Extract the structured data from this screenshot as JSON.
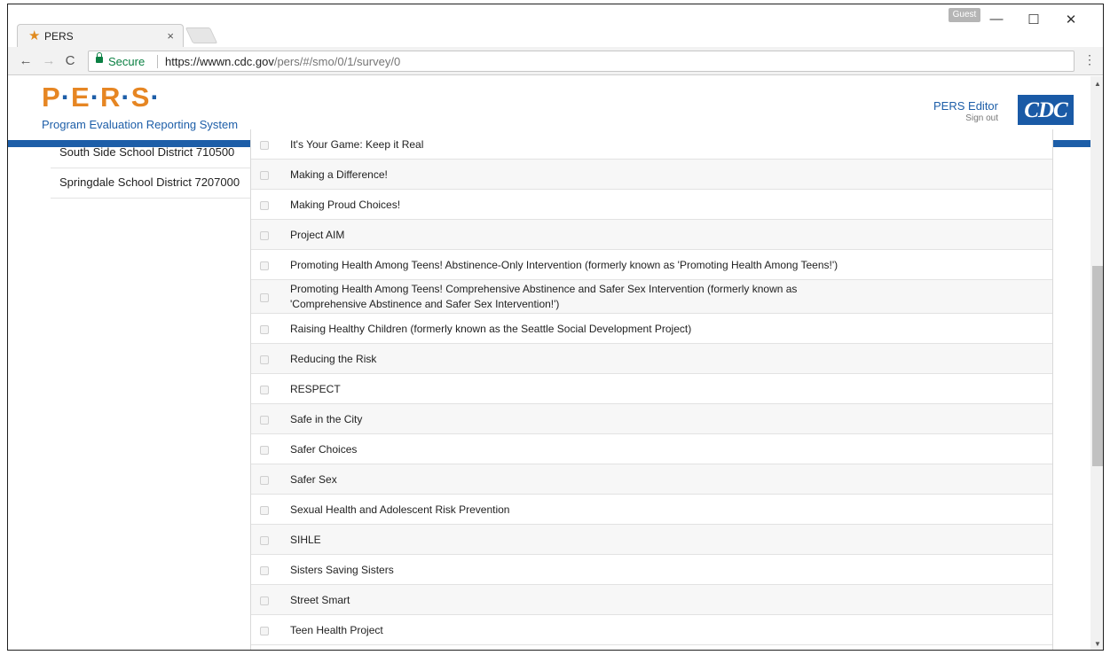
{
  "browser": {
    "tab_title": "PERS",
    "tab_close": "×",
    "profile": "Guest",
    "security_label": "Secure",
    "url_host": "https://wwwn.cdc.gov",
    "url_path": "/pers/#/smo/0/1/survey/0",
    "window_controls": {
      "minimize": "—",
      "maximize": "☐",
      "close": "✕"
    },
    "nav": {
      "back": "←",
      "forward": "→",
      "reload": "C",
      "menu": "⋮"
    }
  },
  "header": {
    "logo_letters": [
      "P",
      "E",
      "R",
      "S"
    ],
    "logo_sub": "Program Evaluation Reporting System",
    "editor_label": "PERS Editor",
    "signout_label": "Sign out",
    "cdc_logo": "CDC"
  },
  "sidebar": {
    "districts": [
      "South Side School District 710500",
      "Springdale School District 7207000"
    ]
  },
  "programs": [
    "It's Your Game: Keep it Real",
    "Making a Difference!",
    "Making Proud Choices!",
    "Project AIM",
    "Promoting Health Among Teens! Abstinence-Only Intervention (formerly known as 'Promoting Health Among Teens!')",
    "Promoting Health Among Teens! Comprehensive Abstinence and Safer Sex Intervention (formerly known as\n'Comprehensive Abstinence and Safer Sex Intervention!')",
    "Raising Healthy Children (formerly known as the Seattle Social Development Project)",
    "Reducing the Risk",
    "RESPECT",
    "Safe in the City",
    "Safer Choices",
    "Safer Sex",
    "Sexual Health and Adolescent Risk Prevention",
    "SIHLE",
    "Sisters Saving Sisters",
    "Street Smart",
    "Teen Health Project"
  ],
  "colors": {
    "brand_orange": "#e68623",
    "brand_blue": "#1d5ea8",
    "secure_green": "#0b8043"
  }
}
